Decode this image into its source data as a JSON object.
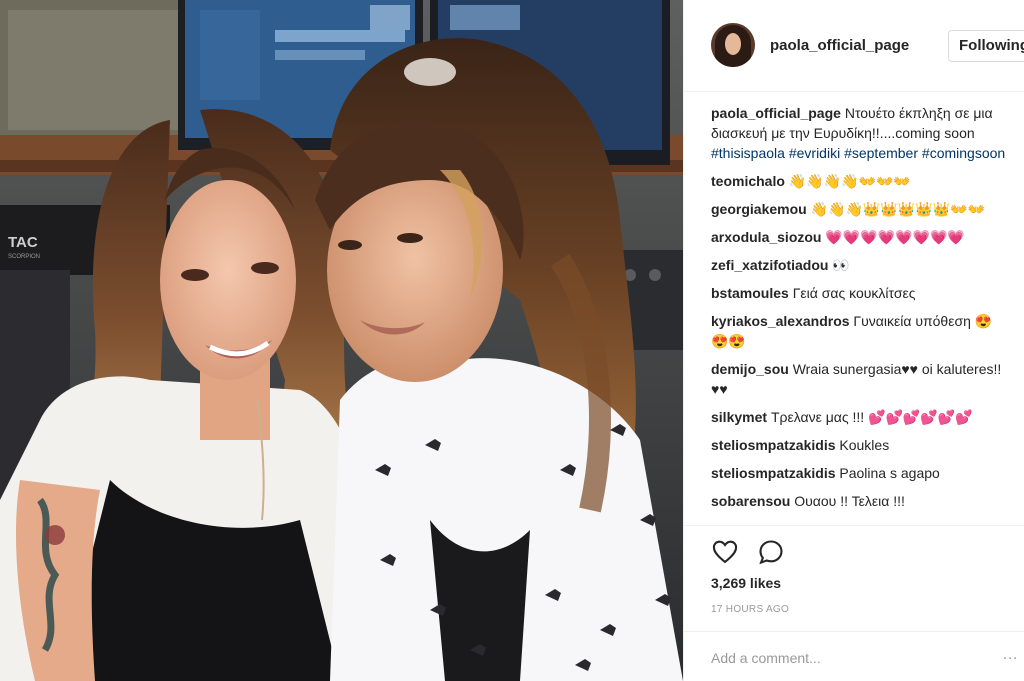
{
  "post": {
    "username": "paola_official_page",
    "follow_label": "Following",
    "caption": {
      "username": "paola_official_page",
      "text": "Ντουέτο έκπληξη σε μια διασκευή με την Ευρυδίκη!!....coming soon",
      "hashtags": [
        "#thisispaola",
        "#evridiki",
        "#september",
        "#comingsoon"
      ]
    },
    "comments": [
      {
        "user": "teomichalo",
        "text": "👋👋👋👋👐👐👐"
      },
      {
        "user": "georgiakemou",
        "text": "👋👋👋👑👑👑👑👑👐👐"
      },
      {
        "user": "arxodula_siozou",
        "text": "💗💗💗💗💗💗💗💗"
      },
      {
        "user": "zefi_xatzifotiadou",
        "text": "👀"
      },
      {
        "user": "bstamoules",
        "text": "Γειά σας κουκλίτσες"
      },
      {
        "user": "kyriakos_alexandros",
        "text": "Γυναικεία υπόθεση 😍😍😍"
      },
      {
        "user": "demijo_sou",
        "text": "Wraia sunergasia♥♥ oi kaluteres!!♥♥"
      },
      {
        "user": "silkymet",
        "text": "Τρελανε μας !!! 💕💕💕💕💕💕"
      },
      {
        "user": "steliosmpatzakidis",
        "text": "Koukles"
      },
      {
        "user": "steliosmpatzakidis",
        "text": "Paolina s agapo"
      },
      {
        "user": "sobarensou",
        "text": "Ουαου !! Τελεια !!!"
      }
    ],
    "likes": "3,269 likes",
    "time": "17 HOURS AGO",
    "comment_placeholder": "Add a comment...",
    "more_options": "…",
    "studio_label": "TAC",
    "studio_sublabel": "SCORPION"
  },
  "icons": {
    "like": "heart-icon",
    "comment": "comment-bubble-icon",
    "more": "more-options-icon"
  },
  "colors": {
    "hashtag": "#003569",
    "username": "#262626",
    "muted": "#999999",
    "border": "#efefef"
  }
}
